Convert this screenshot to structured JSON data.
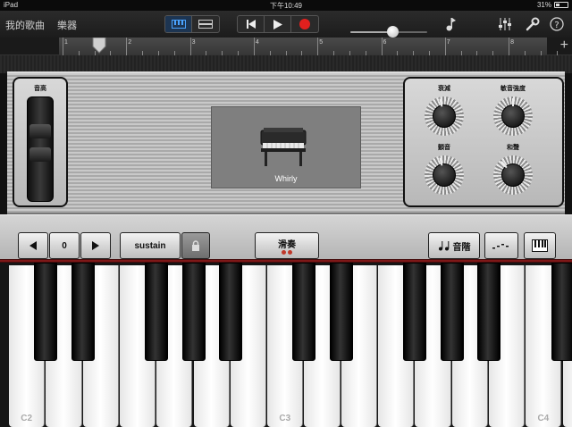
{
  "status_bar": {
    "device": "iPad",
    "time": "下午10:49",
    "battery": "31%",
    "battery_level": 0.31
  },
  "toolbar": {
    "my_songs": "我的歌曲",
    "instruments": "樂器",
    "volume_level": 0.55
  },
  "ruler": {
    "marks": [
      "1",
      "2",
      "3",
      "4",
      "5",
      "6",
      "7",
      "8"
    ]
  },
  "pitch_label": "音高",
  "instrument_name": "Whirly",
  "knobs": [
    {
      "label": "衰減",
      "value": 0.45
    },
    {
      "label": "敏音強度",
      "value": 0.5
    },
    {
      "label": "顫音",
      "value": 0.45
    },
    {
      "label": "和聲",
      "value": 0.35
    }
  ],
  "controls": {
    "octave_value": "0",
    "sustain_label": "sustain",
    "glide_label": "滑奏",
    "scale_label": "音階"
  },
  "keyboard": {
    "labels": {
      "c2": "C2",
      "c3": "C3",
      "c4": "C4"
    }
  },
  "colors": {
    "record": "#e0201e",
    "accent": "#2f7fd6",
    "redline": "#9b1c1c"
  }
}
